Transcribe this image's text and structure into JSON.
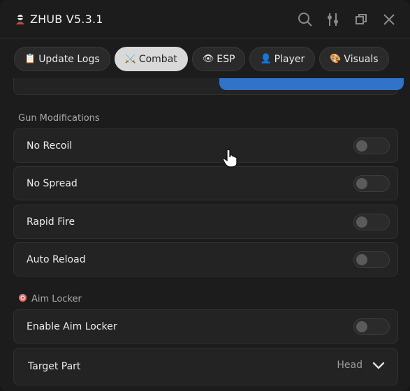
{
  "window": {
    "title": "ZHUB V5.3.1",
    "icons": [
      "app-icon",
      "search-icon",
      "sliders-icon",
      "restore-icon",
      "close-icon"
    ]
  },
  "tabs": [
    {
      "emoji": "📋",
      "label": "Update Logs",
      "active": false
    },
    {
      "emoji": "⚔️",
      "label": "Combat",
      "active": true
    },
    {
      "emoji": "👁",
      "label": "ESP",
      "active": false
    },
    {
      "emoji": "👤",
      "label": "Player",
      "active": false
    },
    {
      "emoji": "🎨",
      "label": "Visuals",
      "active": false
    }
  ],
  "sections": {
    "gun": {
      "title": "Gun Modifications"
    },
    "aim": {
      "title": "Aim Locker",
      "icon": "target-icon"
    }
  },
  "toggles": [
    {
      "label": "No Recoil",
      "on": false
    },
    {
      "label": "No Spread",
      "on": false
    },
    {
      "label": "Rapid Fire",
      "on": false
    },
    {
      "label": "Auto Reload",
      "on": false
    },
    {
      "label": "Enable Aim Locker",
      "on": false
    }
  ],
  "dropdown": {
    "label": "Target Part",
    "value": "Head"
  },
  "colors": {
    "accent": "#2f74c9",
    "active_tab": "#d9d9d9",
    "row_bg": "#232323"
  }
}
